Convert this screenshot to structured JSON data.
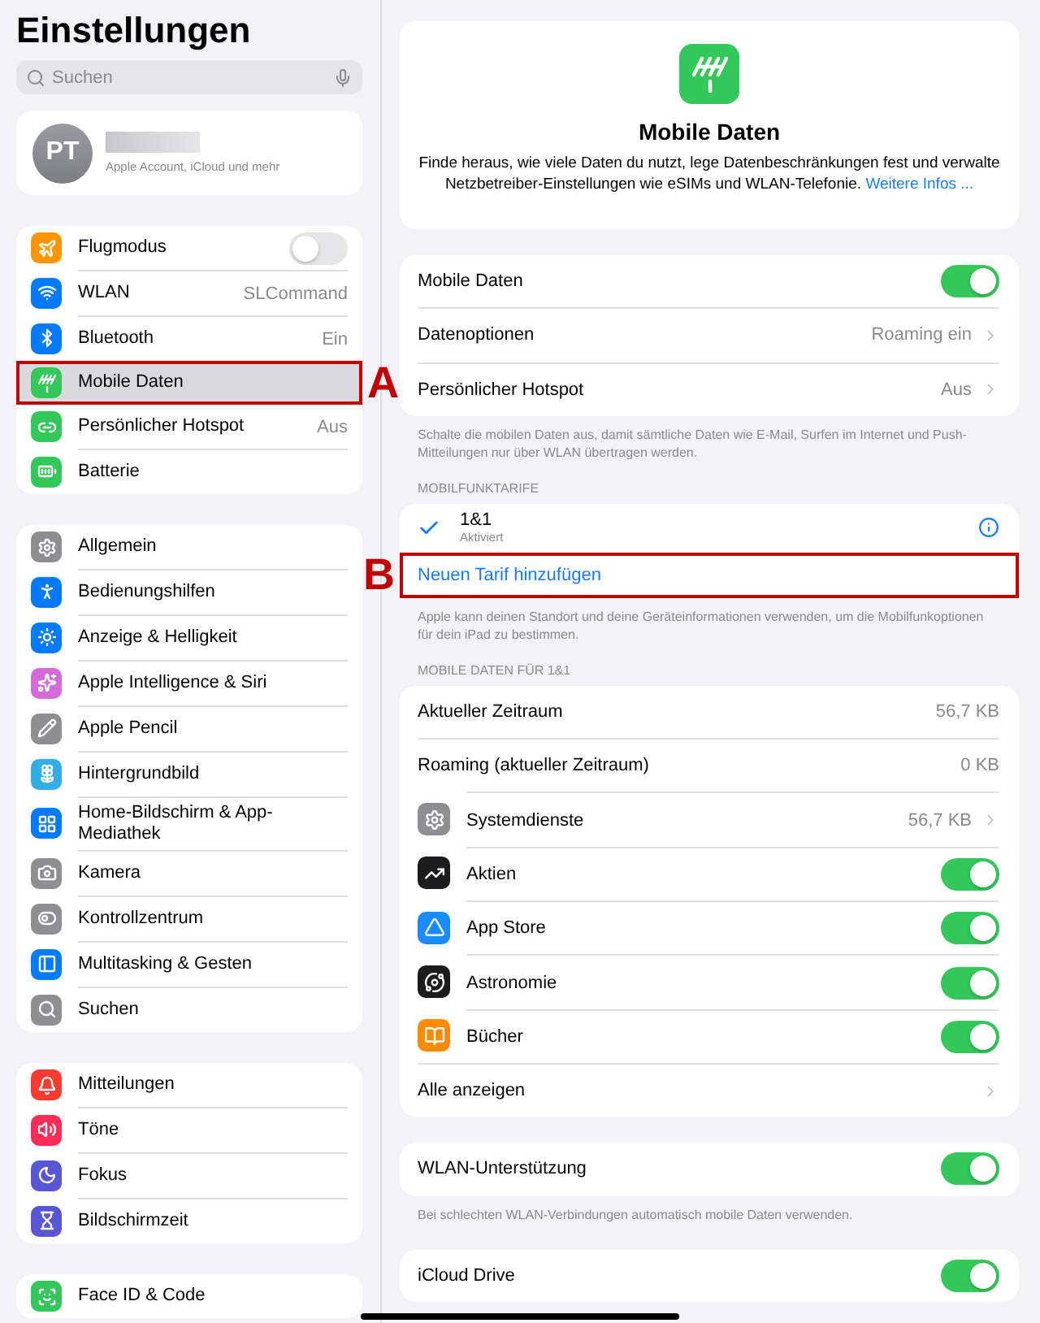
{
  "sidebar": {
    "title": "Einstellungen",
    "search": {
      "placeholder": "Suchen"
    },
    "profile": {
      "initials": "PT",
      "name_redacted": true,
      "subtitle": "Apple Account, iCloud und mehr"
    },
    "groups": [
      {
        "items": [
          {
            "label": "Flugmodus",
            "kind": "toggle",
            "on": false,
            "color": "#ff9500",
            "selected": false
          },
          {
            "label": "WLAN",
            "kind": "value",
            "value": "SLCommand",
            "color": "#007aff",
            "selected": false
          },
          {
            "label": "Bluetooth",
            "kind": "value",
            "value": "Ein",
            "color": "#007aff",
            "selected": false
          },
          {
            "label": "Mobile Daten",
            "kind": "plain",
            "color": "#34c759",
            "selected": true,
            "marker": "A"
          },
          {
            "label": "Persönlicher Hotspot",
            "kind": "value",
            "value": "Aus",
            "color": "#34c759",
            "selected": false
          },
          {
            "label": "Batterie",
            "kind": "plain",
            "color": "#34c759",
            "selected": false
          }
        ]
      },
      {
        "items": [
          {
            "label": "Allgemein",
            "kind": "plain",
            "color": "#8e8e93",
            "selected": false
          },
          {
            "label": "Bedienungshilfen",
            "kind": "plain",
            "color": "#007aff",
            "selected": false
          },
          {
            "label": "Anzeige & Helligkeit",
            "kind": "plain",
            "color": "#007aff",
            "selected": false
          },
          {
            "label": "Apple Intelligence & Siri",
            "kind": "plain",
            "color": "#d46bd9",
            "selected": false
          },
          {
            "label": "Apple Pencil",
            "kind": "plain",
            "color": "#8e8e93",
            "selected": false
          },
          {
            "label": "Hintergrundbild",
            "kind": "plain",
            "color": "#32ade6",
            "selected": false
          },
          {
            "label": "Home-Bildschirm & App-Mediathek",
            "kind": "plain",
            "color": "#007aff",
            "selected": false
          },
          {
            "label": "Kamera",
            "kind": "plain",
            "color": "#8e8e93",
            "selected": false
          },
          {
            "label": "Kontrollzentrum",
            "kind": "plain",
            "color": "#8e8e93",
            "selected": false
          },
          {
            "label": "Multitasking & Gesten",
            "kind": "plain",
            "color": "#007aff",
            "selected": false
          },
          {
            "label": "Suchen",
            "kind": "plain",
            "color": "#8e8e93",
            "selected": false
          }
        ]
      },
      {
        "items": [
          {
            "label": "Mitteilungen",
            "kind": "plain",
            "color": "#ff3b30",
            "selected": false
          },
          {
            "label": "Töne",
            "kind": "plain",
            "color": "#ff2d55",
            "selected": false
          },
          {
            "label": "Fokus",
            "kind": "plain",
            "color": "#5856d6",
            "selected": false
          },
          {
            "label": "Bildschirmzeit",
            "kind": "plain",
            "color": "#5856d6",
            "selected": false
          }
        ]
      },
      {
        "items": [
          {
            "label": "Face ID & Code",
            "kind": "plain",
            "color": "#34c759",
            "selected": false
          }
        ]
      }
    ]
  },
  "detail": {
    "intro": {
      "title": "Mobile Daten",
      "description": "Finde heraus, wie viele Daten du nutzt, lege Datenbeschränkungen fest und verwalte Netzbetreiber-Einstellungen wie eSIMs und WLAN-Telefonie.",
      "link": "Weitere Infos ..."
    },
    "sections": [
      {
        "rows": [
          {
            "kind": "toggle",
            "label": "Mobile Daten",
            "on": true
          },
          {
            "kind": "detail",
            "label": "Datenoptionen",
            "value": "Roaming ein",
            "chevron": true
          },
          {
            "kind": "detail",
            "label": "Persönlicher Hotspot",
            "value": "Aus",
            "chevron": true
          }
        ],
        "footer": "Schalte die mobilen Daten aus, damit sämtliche Daten wie E-Mail, Surfen im Internet und Push-Mitteilungen nur über WLAN übertragen werden."
      },
      {
        "header": "MOBILFUNKTARIFE",
        "rows": [
          {
            "kind": "tariff",
            "label": "1&1",
            "status": "Aktiviert",
            "checked": true
          },
          {
            "kind": "link",
            "label": "Neuen Tarif hinzufügen",
            "marker": "B"
          }
        ],
        "footer": "Apple kann deinen Standort und deine Geräteinformationen verwenden, um die Mobilfunkoptionen für dein iPad zu bestimmen."
      },
      {
        "header": "MOBILE DATEN FÜR 1&1",
        "rows": [
          {
            "kind": "detail",
            "label": "Aktueller Zeitraum",
            "value": "56,7 KB"
          },
          {
            "kind": "detail",
            "label": "Roaming (aktueller Zeitraum)",
            "value": "0 KB"
          },
          {
            "kind": "detail",
            "label": "Systemdienste",
            "value": "56,7 KB",
            "chevron": true,
            "color": "#8e8e93"
          },
          {
            "kind": "toggle",
            "label": "Aktien",
            "on": true,
            "color": "#1c1c1e"
          },
          {
            "kind": "toggle",
            "label": "App Store",
            "on": true,
            "color": "#1a8cff"
          },
          {
            "kind": "toggle",
            "label": "Astronomie",
            "on": true,
            "color": "#1c1c1e"
          },
          {
            "kind": "toggle",
            "label": "Bücher",
            "on": true,
            "color": "#ff8a00"
          },
          {
            "kind": "detail",
            "label": "Alle anzeigen",
            "chevron": true
          }
        ]
      },
      {
        "rows": [
          {
            "kind": "toggle",
            "label": "WLAN-Unterstützung",
            "on": true
          }
        ],
        "footer": "Bei schlechten WLAN-Verbindungen automatisch mobile Daten verwenden."
      },
      {
        "rows": [
          {
            "kind": "toggle",
            "label": "iCloud Drive",
            "on": true
          }
        ]
      }
    ]
  }
}
